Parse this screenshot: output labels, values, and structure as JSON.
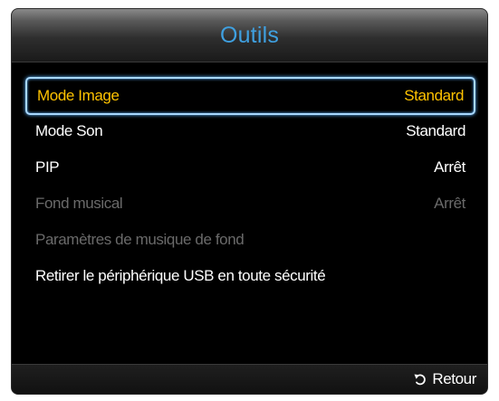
{
  "dialog": {
    "title": "Outils"
  },
  "menu": {
    "items": [
      {
        "label": "Mode Image",
        "value": "Standard",
        "state": "selected"
      },
      {
        "label": "Mode Son",
        "value": "Standard",
        "state": "normal"
      },
      {
        "label": "PIP",
        "value": "Arrêt",
        "state": "normal"
      },
      {
        "label": "Fond musical",
        "value": "Arrêt",
        "state": "disabled"
      },
      {
        "label": "Paramètres de musique de fond",
        "value": "",
        "state": "disabled"
      },
      {
        "label": "Retirer le périphérique USB en toute sécurité",
        "value": "",
        "state": "normal"
      }
    ]
  },
  "footer": {
    "return_label": "Retour",
    "return_icon": "return-arrow-icon"
  },
  "colors": {
    "title": "#3fa0e0",
    "selected_text": "#ffc300",
    "normal_text": "#ffffff",
    "disabled_text": "#6a6a6a",
    "focus_border": "#a8d8ff",
    "background": "#000000"
  }
}
